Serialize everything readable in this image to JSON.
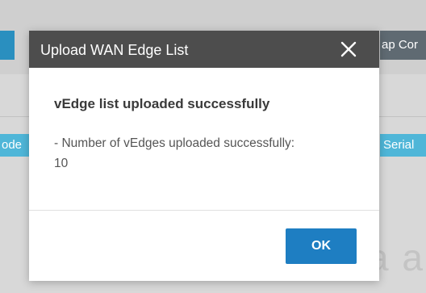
{
  "background": {
    "right_top_fragment": "ap Cor",
    "left_mid_fragment": "ode",
    "right_mid_fragment": "Serial",
    "faint_fragment": "a a"
  },
  "dialog": {
    "title": "Upload WAN Edge List",
    "close_icon": "close-icon",
    "heading": "vEdge list uploaded successfully",
    "count_label": "- Number of vEdges uploaded successfully:",
    "count_value": "10",
    "ok_label": "OK"
  },
  "colors": {
    "header_bg": "#4d4d4d",
    "ok_button_bg": "#1e7ec2",
    "bg_tab_blue": "#4fb6d8"
  }
}
